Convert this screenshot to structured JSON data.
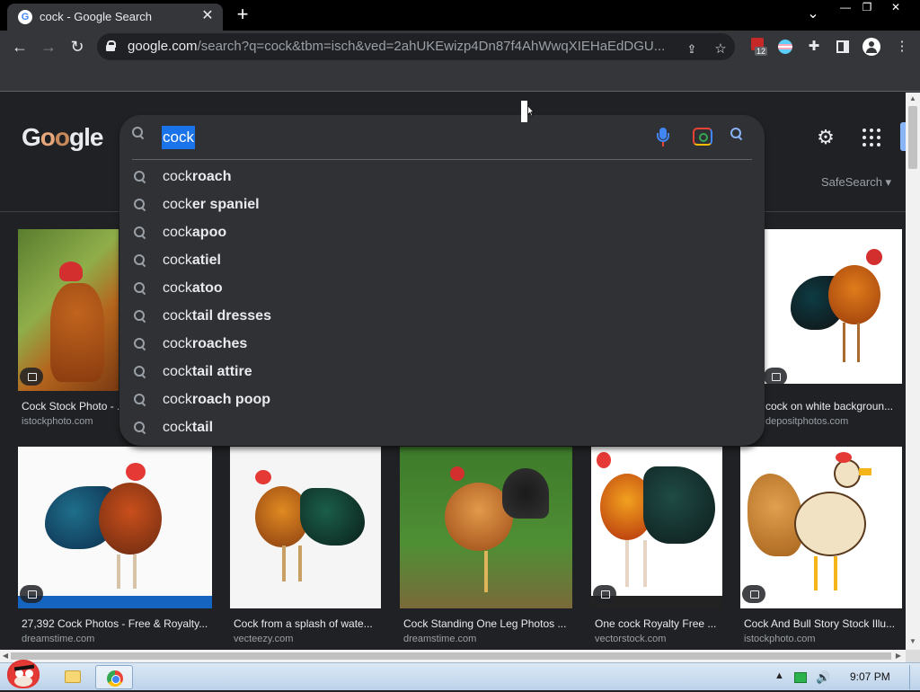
{
  "browser": {
    "tab_title": "cock - Google Search",
    "favicon_letter": "G",
    "close_glyph": "✕",
    "newtab_glyph": "+",
    "window_controls": [
      "—",
      "❐",
      "✕"
    ],
    "tab_list_glyph": "⌄",
    "url_host": "google.com",
    "url_rest": "/search?q=cock&tbm=isch&ved=2ahUKEwizp4Dn87f4AhWwqXIEHaEdDGU...",
    "extension_badge": "12"
  },
  "page": {
    "logo_text": [
      "G",
      "o",
      "o",
      "gle"
    ],
    "safesearch_label": "SafeSearch",
    "search": {
      "query": "cock",
      "suggestions": [
        {
          "typed": "cock",
          "completion": "roach"
        },
        {
          "typed": "cock",
          "completion": "er spaniel"
        },
        {
          "typed": "cock",
          "completion": "apoo"
        },
        {
          "typed": "cock",
          "completion": "atiel"
        },
        {
          "typed": "cock",
          "completion": "atoo"
        },
        {
          "typed": "cock",
          "completion": "tail dresses"
        },
        {
          "typed": "cock",
          "completion": "roaches"
        },
        {
          "typed": "cock",
          "completion": "tail attire"
        },
        {
          "typed": "cock",
          "completion": "roach poop"
        },
        {
          "typed": "cock",
          "completion": "tail"
        }
      ]
    },
    "images_row1": [
      {
        "caption": "Cock Stock Photo - ...",
        "source": "istockphoto.com"
      },
      {
        "caption": "cock on white backgroun...",
        "source": "depositphotos.com"
      }
    ],
    "images_row2": [
      {
        "caption": "27,392 Cock Photos - Free & Royalty...",
        "source": "dreamstime.com"
      },
      {
        "caption": "Cock from a splash of wate...",
        "source": "vecteezy.com"
      },
      {
        "caption": "Cock Standing One Leg Photos ...",
        "source": "dreamstime.com"
      },
      {
        "caption": "One cock Royalty Free ...",
        "source": "vectorstock.com"
      },
      {
        "caption": "Cock And Bull Story Stock Illu...",
        "source": "istockphoto.com"
      }
    ]
  },
  "taskbar": {
    "clock": "9:07 PM"
  },
  "colors": {
    "page_bg": "#202124",
    "dropdown_bg": "#303134",
    "selection": "#1a73e8",
    "accent_blue": "#8ab4f8"
  }
}
